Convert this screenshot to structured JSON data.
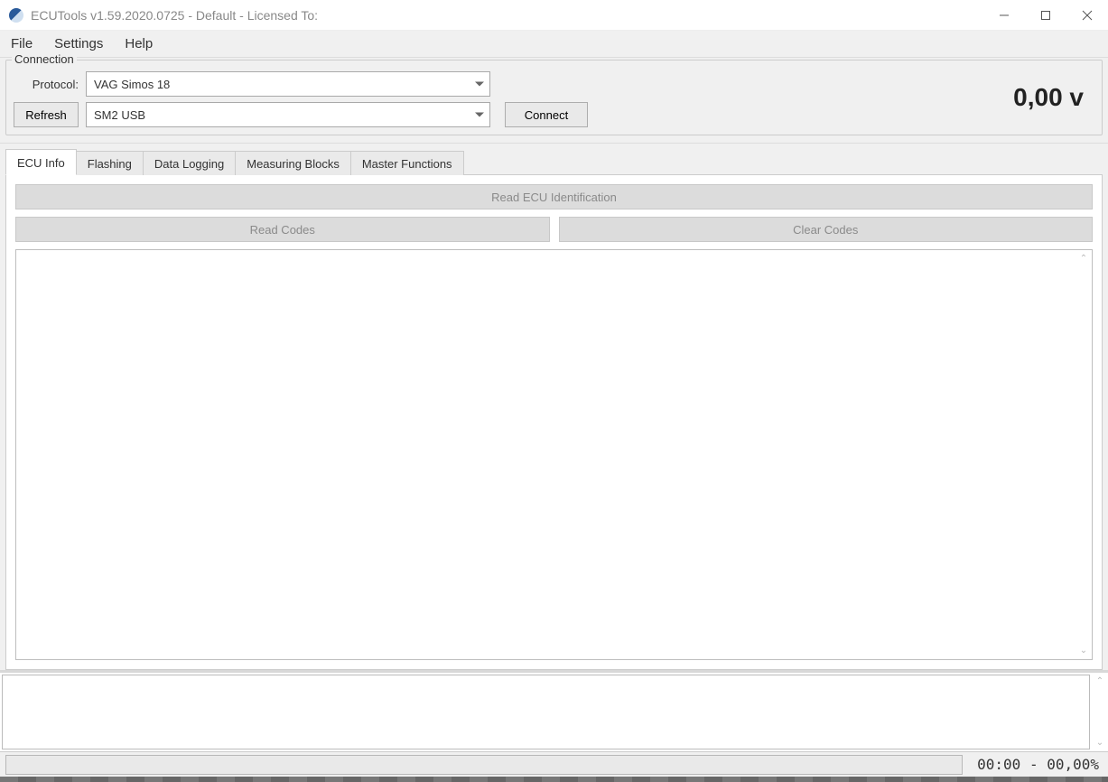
{
  "window": {
    "title": "ECUTools v1.59.2020.0725 - Default - Licensed To:"
  },
  "menu": {
    "items": [
      "File",
      "Settings",
      "Help"
    ]
  },
  "connection": {
    "legend": "Connection",
    "protocol_label": "Protocol:",
    "protocol_value": "VAG Simos 18",
    "refresh_label": "Refresh",
    "interface_value": "SM2 USB",
    "connect_label": "Connect",
    "voltage": "0,00 v"
  },
  "tabs": {
    "items": [
      "ECU Info",
      "Flashing",
      "Data Logging",
      "Measuring Blocks",
      "Master Functions"
    ],
    "active_index": 0
  },
  "ecu_info": {
    "read_id_label": "Read ECU Identification",
    "read_codes_label": "Read Codes",
    "clear_codes_label": "Clear Codes"
  },
  "status": {
    "text": "00:00 - 00,00%"
  }
}
